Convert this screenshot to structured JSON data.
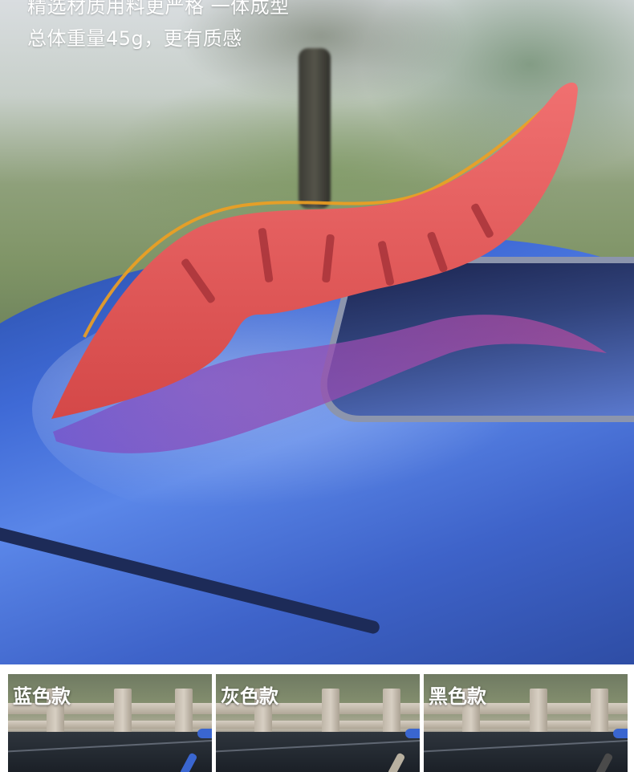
{
  "hero": {
    "caption_line1": "精选材质用料更严格 一体成型",
    "caption_line2": "总体重量45g，更有质感",
    "product_color": "#e85a5a",
    "roof_color": "#3f6ad6",
    "highlight_color": "#f0a020"
  },
  "swatches": [
    {
      "label": "蓝色款",
      "tip_color": "#3a66d0"
    },
    {
      "label": "灰色款",
      "tip_color": "#b8b0a0"
    },
    {
      "label": "黑色款",
      "tip_color": "#4a4a4a"
    }
  ]
}
